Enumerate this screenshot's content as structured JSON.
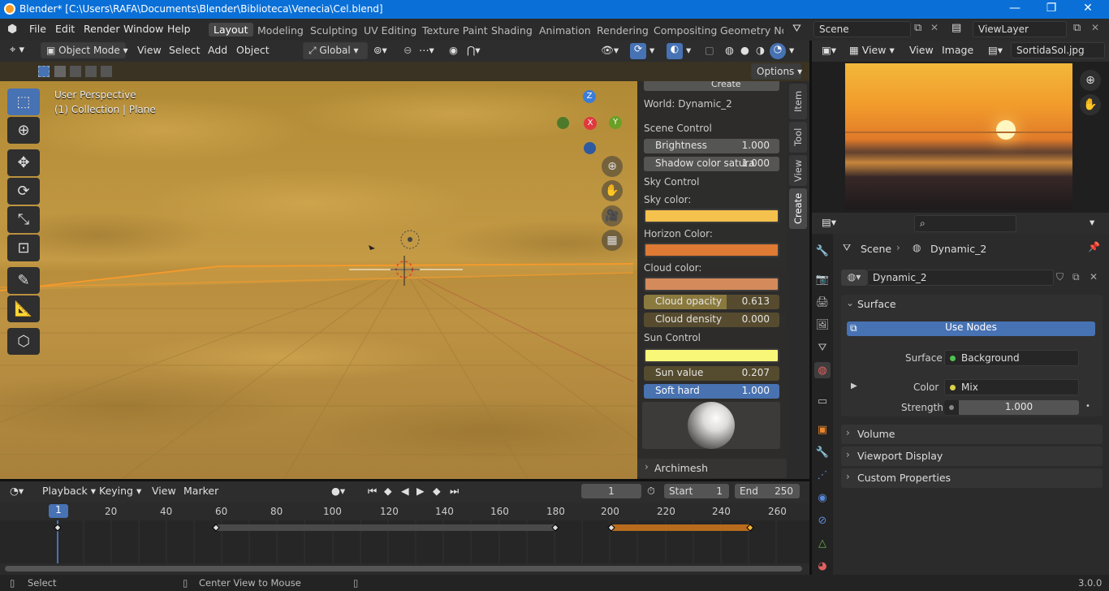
{
  "titlebar": {
    "title": "Blender* [C:\\Users\\RAFA\\Documents\\Blender\\Biblioteca\\Venecia\\Cel.blend]",
    "minimize": "—",
    "maximize": "❐",
    "close": "✕"
  },
  "menu": [
    "File",
    "Edit",
    "Render",
    "Window",
    "Help"
  ],
  "workspaces": [
    "Layout",
    "Modeling",
    "Sculpting",
    "UV Editing",
    "Texture Paint",
    "Shading",
    "Animation",
    "Rendering",
    "Compositing",
    "Geometry Nod"
  ],
  "scene": "Scene",
  "view_layer": "ViewLayer",
  "header3d": {
    "mode": "Object Mode",
    "view": "View",
    "select": "Select",
    "add": "Add",
    "object": "Object",
    "orientation": "Global",
    "options": "Options"
  },
  "viewport": {
    "perspective": "User Perspective",
    "collection": "(1) Collection | Plane",
    "axes": {
      "z": "Z",
      "y": "Y",
      "x": "X"
    }
  },
  "npanel": {
    "create_btn": "Create",
    "world": "World: Dynamic_2",
    "scene_control": "Scene Control",
    "brightness_label": "Brightness",
    "brightness": "1.000",
    "shadow_label": "Shadow color satura",
    "shadow": "1.000",
    "sky_control": "Sky Control",
    "sky_color": "Sky color:",
    "horizon_color": "Horizon Color:",
    "cloud_color": "Cloud color:",
    "cloud_opacity_label": "Cloud opacity",
    "cloud_opacity": "0.613",
    "cloud_opacity_frac": 0.613,
    "cloud_density_label": "Cloud density",
    "cloud_density": "0.000",
    "sun_control": "Sun Control",
    "sun_value_label": "Sun value",
    "sun_value": "0.207",
    "soft_hard_label": "Soft hard",
    "soft_hard": "1.000",
    "archimesh": "Archimesh",
    "tabs": [
      "Item",
      "Tool",
      "View",
      "Create"
    ],
    "colors": {
      "sky": "#f7c24e",
      "horizon": "#e07a35",
      "cloud": "#d58a5c",
      "sun": "#fafa7a"
    }
  },
  "timeline": {
    "playback": "Playback",
    "keying": "Keying",
    "view": "View",
    "marker": "Marker",
    "current_frame": "1",
    "start_label": "Start",
    "start": "1",
    "end_label": "End",
    "end": "250",
    "ticks": [
      "20",
      "40",
      "60",
      "80",
      "100",
      "120",
      "140",
      "160",
      "180",
      "200",
      "220",
      "240",
      "260"
    ],
    "playhead": "1"
  },
  "status": {
    "select": "Select",
    "center": "Center View to Mouse",
    "version": "3.0.0"
  },
  "image_editor": {
    "view": "View",
    "view2": "View",
    "image": "Image",
    "file": "SortidaSol.jpg"
  },
  "properties": {
    "breadcrumb_scene": "Scene",
    "breadcrumb_world": "Dynamic_2",
    "world_name": "Dynamic_2",
    "surface_section": "Surface",
    "use_nodes": "Use Nodes",
    "surface_label": "Surface",
    "surface_value": "Background",
    "color_label": "Color",
    "color_value": "Mix",
    "strength_label": "Strength",
    "strength_value": "1.000",
    "volume": "Volume",
    "viewport_display": "Viewport Display",
    "custom_properties": "Custom Properties"
  }
}
